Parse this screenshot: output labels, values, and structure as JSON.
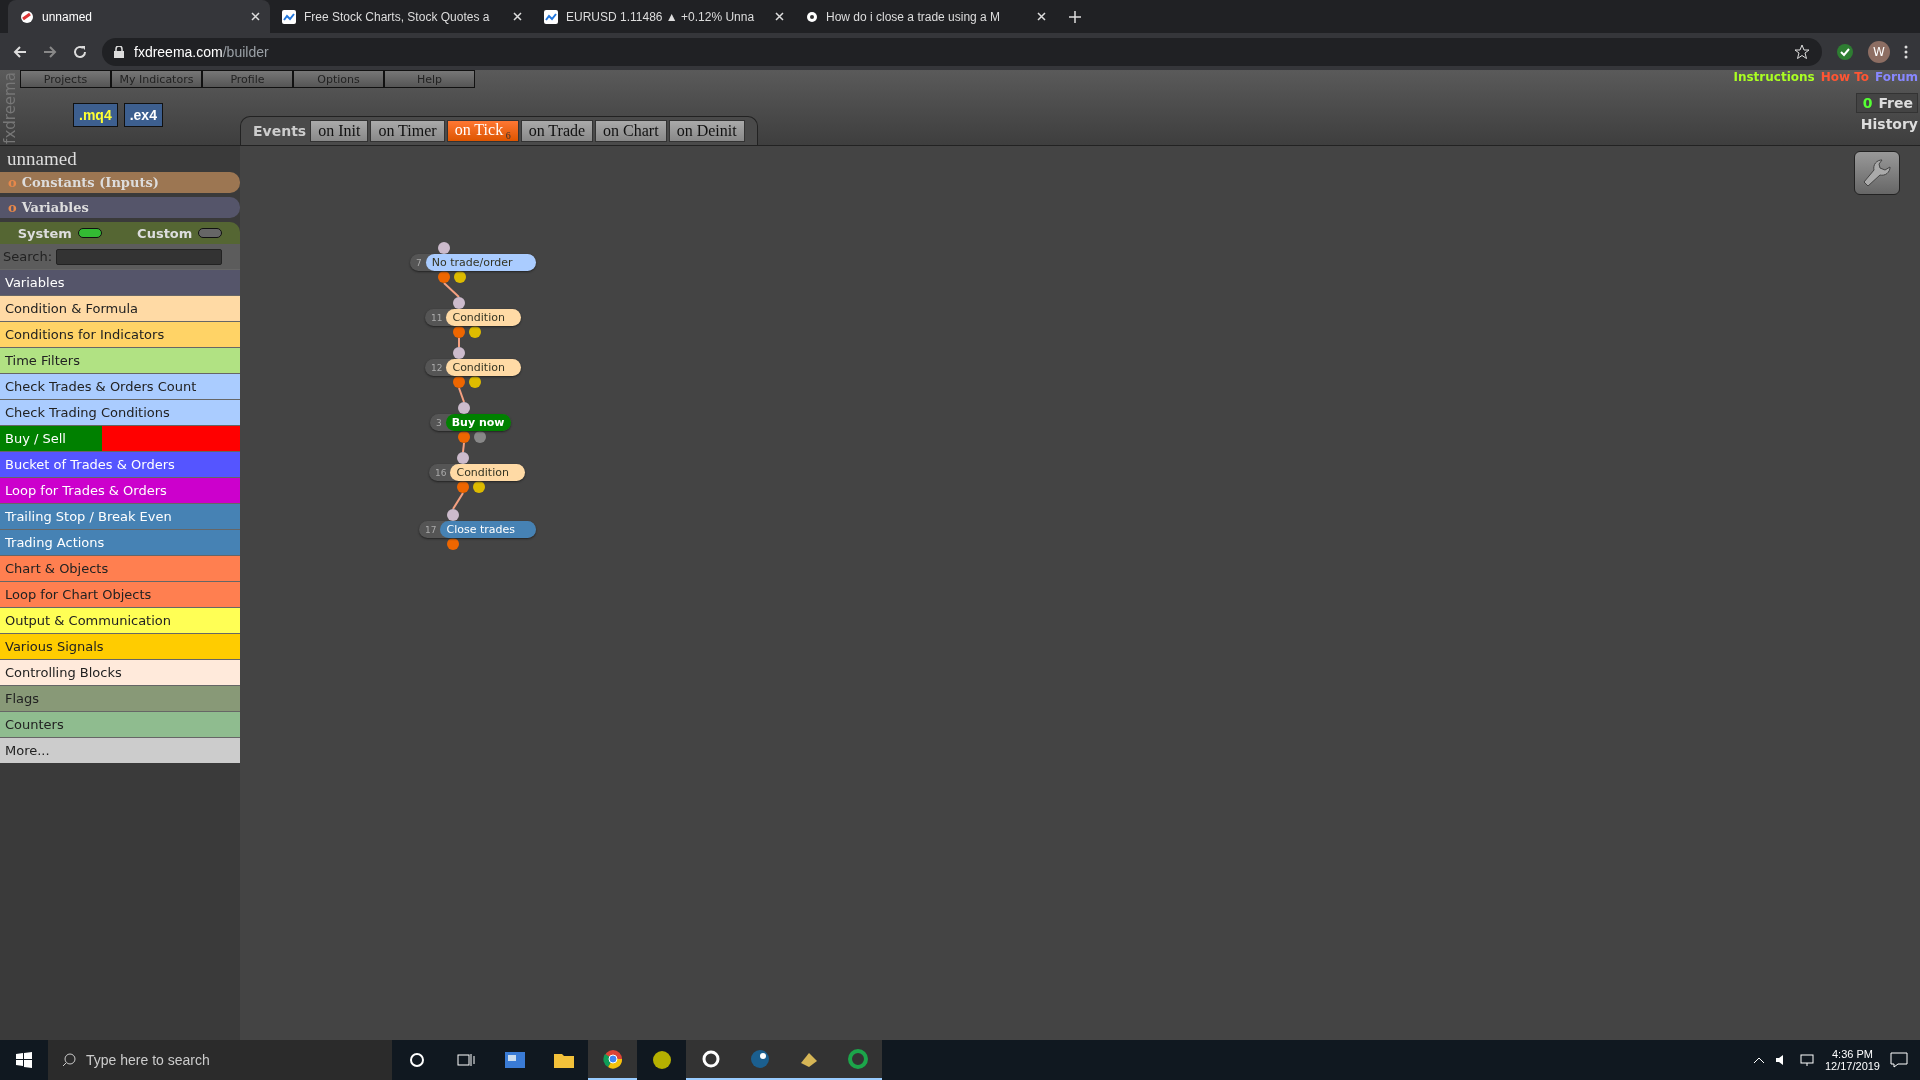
{
  "browser": {
    "tabs": [
      {
        "title": "unnamed",
        "selected": true
      },
      {
        "title": "Free Stock Charts, Stock Quotes a",
        "selected": false
      },
      {
        "title": "EURUSD 1.11486 ▲ +0.12% Unna",
        "selected": false
      },
      {
        "title": "How do i close a trade using a M",
        "selected": false
      }
    ],
    "url": {
      "host": "fxdreema.com",
      "path": "/builder"
    },
    "profile": "W"
  },
  "app": {
    "logo": "fxdreema",
    "menu": [
      "Projects",
      "My Indicators",
      "Profile",
      "Options",
      "Help"
    ],
    "export_buttons": [
      ".mq4",
      ".ex4"
    ],
    "links": [
      {
        "label": "Instructions",
        "color": "#aaff22"
      },
      {
        "label": "How To",
        "color": "#ff5533"
      },
      {
        "label": "Forum",
        "color": "#8888ff"
      }
    ],
    "free_count": "0",
    "free_label": "Free",
    "history": "History",
    "events_label": "Events",
    "event_tabs": [
      {
        "label": "on Init",
        "selected": false
      },
      {
        "label": "on Timer",
        "selected": false
      },
      {
        "label": "on Tick",
        "selected": true,
        "badge": "6"
      },
      {
        "label": "on Trade",
        "selected": false
      },
      {
        "label": "on Chart",
        "selected": false
      },
      {
        "label": "on Deinit",
        "selected": false
      }
    ]
  },
  "sidebar": {
    "project": "unnamed",
    "sections": [
      {
        "marker": "o",
        "label": "Constants (Inputs)",
        "color": "#9c7652"
      },
      {
        "marker": "o",
        "label": "Variables",
        "color": "#55556a"
      }
    ],
    "toggles": [
      {
        "label": "System",
        "on": true
      },
      {
        "label": "Custom",
        "on": false
      }
    ],
    "search_label": "Search:",
    "categories": [
      {
        "label": "Variables",
        "color": "#55556a"
      },
      {
        "label": "Condition & Formula",
        "color": "#ffdaa5"
      },
      {
        "label": "Conditions for Indicators",
        "color": "#ffd366"
      },
      {
        "label": "Time Filters",
        "color": "#b1e283"
      },
      {
        "label": "Check Trades & Orders Count",
        "color": "#aaccff"
      },
      {
        "label": "Check Trading Conditions",
        "color": "#aaccff"
      },
      {
        "label": "Buy / Sell",
        "halves": [
          {
            "color": "#008000"
          },
          {
            "color": "#ff0000"
          }
        ]
      },
      {
        "label": "Bucket of Trades & Orders",
        "color": "#5555ff"
      },
      {
        "label": "Loop for Trades & Orders",
        "color": "#cc00cc"
      },
      {
        "label": "Trailing Stop / Break Even",
        "color": "#4682b4"
      },
      {
        "label": "Trading Actions",
        "color": "#4682b4"
      },
      {
        "label": "Chart & Objects",
        "color": "#ff7f50"
      },
      {
        "label": "Loop for Chart Objects",
        "color": "#ff7f50"
      },
      {
        "label": "Output & Communication",
        "color": "#ffff55"
      },
      {
        "label": "Various Signals",
        "color": "#ffcc00"
      },
      {
        "label": "Controlling Blocks",
        "color": "#ffeadb"
      },
      {
        "label": "Flags",
        "color": "#889977"
      },
      {
        "label": "Counters",
        "color": "#8fbc8f"
      },
      {
        "label": "More...",
        "color": "#cccccc"
      }
    ]
  },
  "canvas": {
    "blocks": [
      {
        "number": "7",
        "label": "No trade/order",
        "color": "#aaccff",
        "kind": "filter"
      },
      {
        "number": "11",
        "label": "Condition",
        "color": "#ffdaa5",
        "kind": "filter"
      },
      {
        "number": "12",
        "label": "Condition",
        "color": "#ffdaa5",
        "kind": "filter"
      },
      {
        "number": "3",
        "label": "Buy now",
        "color": "#008000",
        "kind": "action"
      },
      {
        "number": "16",
        "label": "Condition",
        "color": "#ffdaa5",
        "kind": "filter"
      },
      {
        "number": "17",
        "label": "Close trades",
        "color": "#4682b4",
        "kind": "end"
      }
    ]
  },
  "taskbar": {
    "search_placeholder": "Type here to search",
    "time": "4:36 PM",
    "date": "12/17/2019"
  }
}
